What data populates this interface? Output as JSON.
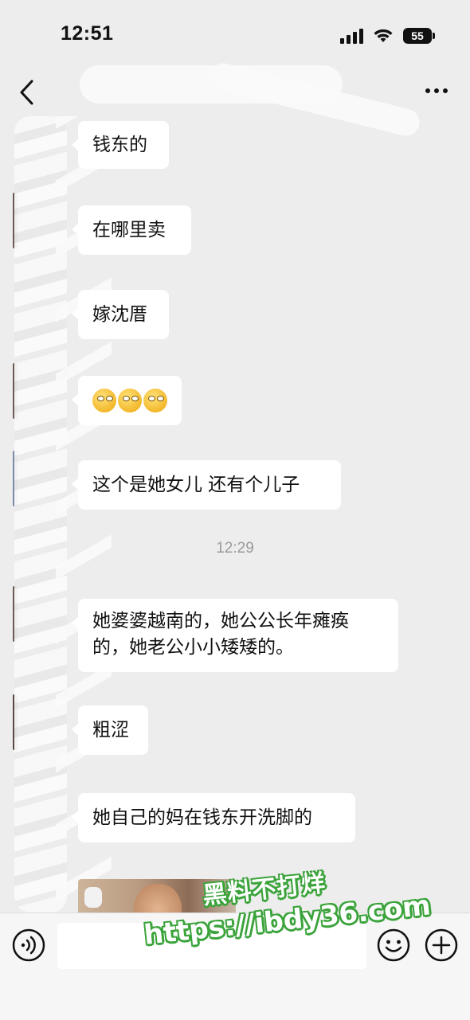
{
  "status_bar": {
    "time": "12:51",
    "battery": "55"
  },
  "header": {
    "title": ""
  },
  "messages": [
    {
      "type": "text",
      "text": "钱东的"
    },
    {
      "type": "text",
      "text": "在哪里卖"
    },
    {
      "type": "text",
      "text": "嫁沈厝"
    },
    {
      "type": "emoji",
      "emoji_name": "monocle-face-emoji",
      "count": 3
    },
    {
      "type": "text",
      "text": "这个是她女儿 还有个儿子"
    },
    {
      "type": "timestamp",
      "text": "12:29"
    },
    {
      "type": "text",
      "lines": [
        "她婆婆越南的，她公公长年瘫痪",
        "的，她老公小小矮矮的。"
      ]
    },
    {
      "type": "text",
      "text": "粗涩"
    },
    {
      "type": "text",
      "text": "她自己的妈在钱东开洗脚的"
    },
    {
      "type": "image"
    }
  ],
  "input_bar": {
    "voice_icon": "voice-icon",
    "emoji_icon": "smiley-icon",
    "plus_icon": "plus-icon"
  },
  "watermark": {
    "line1": "黑料不打烊",
    "line2": "https://ibdy36.com"
  }
}
